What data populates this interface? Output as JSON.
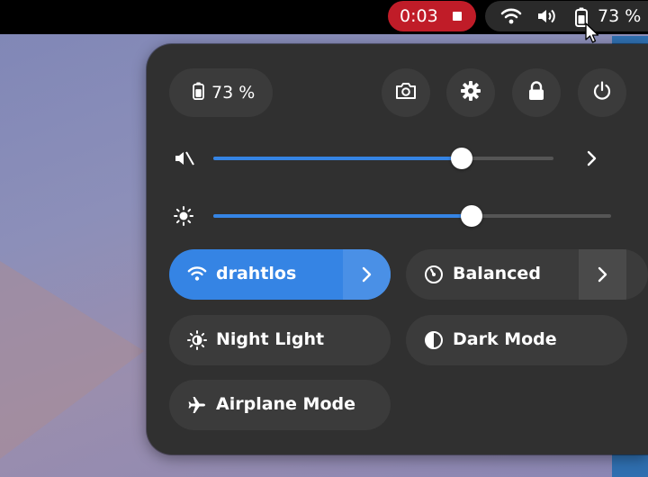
{
  "topbar": {
    "recording_time": "0:03",
    "battery_percent": "73 %"
  },
  "panel": {
    "battery_chip_label": "73 %",
    "volume": {
      "level": 0.73
    },
    "brightness": {
      "level": 0.65
    },
    "toggles": {
      "wifi": {
        "label": "drahtlos",
        "active": true
      },
      "power_profile": {
        "label": "Balanced",
        "active": false
      },
      "night_light": {
        "label": "Night Light",
        "active": false
      },
      "dark_mode": {
        "label": "Dark Mode",
        "active": false
      },
      "airplane_mode": {
        "label": "Airplane Mode",
        "active": false
      }
    }
  },
  "icons": [
    "wifi-icon",
    "volume-icon",
    "battery-icon",
    "camera-icon",
    "gear-icon",
    "lock-icon",
    "power-icon",
    "muted-speaker-icon",
    "brightness-icon",
    "chevron-right-icon",
    "power-profile-icon",
    "night-light-icon",
    "dark-mode-icon",
    "airplane-icon"
  ],
  "colors": {
    "accent": "#3584e4",
    "record": "#c01c28",
    "panel_bg": "#303030",
    "chip_bg": "#3b3b3b"
  }
}
